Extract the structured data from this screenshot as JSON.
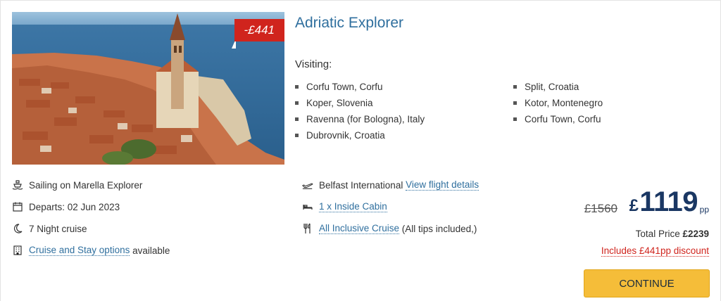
{
  "image": {
    "alt": "",
    "badge": "-£441"
  },
  "cruise": {
    "title": "Adriatic Explorer",
    "visiting_label": "Visiting:",
    "ports_col1": [
      "Corfu Town, Corfu",
      "Koper, Slovenia",
      "Ravenna (for Bologna), Italy",
      "Dubrovnik, Croatia"
    ],
    "ports_col2": [
      "Split, Croatia",
      "Kotor, Montenegro",
      "Corfu Town, Corfu"
    ]
  },
  "details": {
    "ship": "Sailing on Marella Explorer",
    "departs": "Departs: 02 Jun 2023",
    "duration": "7 Night cruise",
    "stay_link": "Cruise and Stay options",
    "stay_suffix": " available",
    "airport": "Belfast International",
    "flight_link": "View flight details",
    "cabin_link": "1 x Inside Cabin",
    "board_link": "All Inclusive Cruise",
    "board_suffix": " (All tips included,)"
  },
  "price": {
    "old": "£1560",
    "currency": "£",
    "amount": "1119",
    "per_person": "pp",
    "total_label": "Total Price ",
    "total_value": "£2239",
    "discount_note": "Includes £441pp discount",
    "continue_label": "CONTINUE"
  },
  "colors": {
    "accent": "#2f6f9e",
    "price": "#1a3763",
    "discount": "#d0241d",
    "button": "#f5bd39"
  },
  "icons": {
    "ship": "ship-icon",
    "calendar": "calendar-icon",
    "moon": "moon-icon",
    "building": "building-icon",
    "plane": "plane-departure-icon",
    "bed": "bed-icon",
    "cutlery": "cutlery-icon"
  }
}
